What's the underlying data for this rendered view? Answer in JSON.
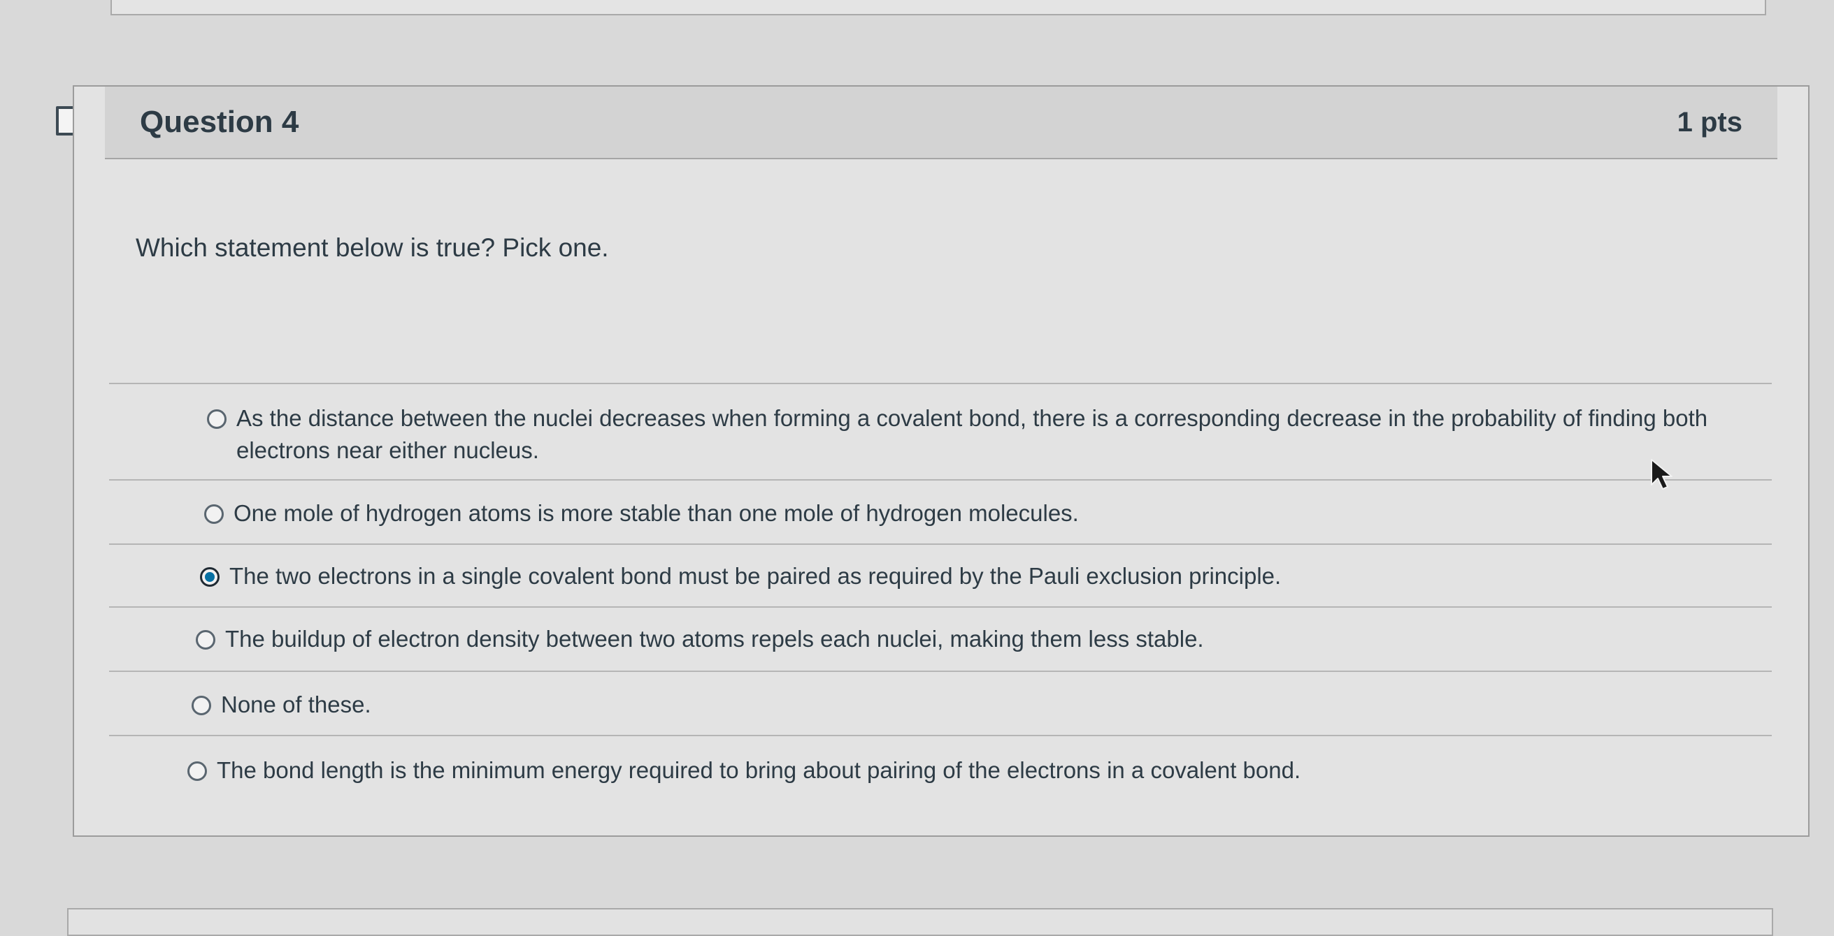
{
  "question": {
    "title": "Question 4",
    "points": "1 pts",
    "text": "Which statement below is true? Pick one."
  },
  "answers": [
    {
      "label": "As the distance between the nuclei decreases when forming a covalent bond, there is a corresponding decrease in the probability of finding both electrons near either nucleus.",
      "selected": false
    },
    {
      "label": "One mole of hydrogen atoms is more stable than one mole of hydrogen molecules.",
      "selected": false
    },
    {
      "label": "The two electrons in a single covalent bond must be paired as required by the Pauli exclusion principle.",
      "selected": true
    },
    {
      "label": "The buildup of electron density between two atoms repels each nuclei, making them less stable.",
      "selected": false
    },
    {
      "label": "None of these.",
      "selected": false
    },
    {
      "label": "The bond length is the minimum energy required to bring about pairing of the electrons in a covalent bond.",
      "selected": false
    }
  ],
  "icons": {
    "flag": "flag-icon",
    "cursor": "mouse-pointer-icon"
  },
  "colors": {
    "radio_selected": "#0770a3",
    "text": "#2d3b45"
  }
}
